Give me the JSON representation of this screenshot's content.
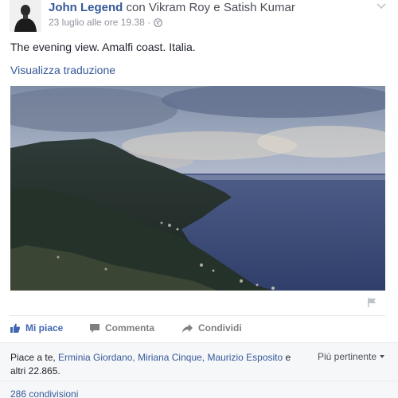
{
  "header": {
    "author": "John Legend",
    "with_word": "con",
    "tagged_1": "Vikram Roy",
    "and_word": "e",
    "tagged_2": "Satish Kumar",
    "timestamp": "23 luglio alle ore 19.38 ·",
    "privacy_icon": "globe-icon",
    "menu_icon": "chevron-down-icon"
  },
  "post": {
    "text": "The evening view. Amalfi coast. Italia.",
    "translate": "Visualizza traduzione"
  },
  "actions": {
    "like": "Mi piace",
    "comment": "Commenta",
    "share": "Condividi"
  },
  "likes": {
    "prefix": "Piace a te, ",
    "names": "Erminia Giordano, Miriana Cinque, Maurizio Esposito",
    "suffix": " e altri 22.865."
  },
  "sort": {
    "label": "Più pertinente"
  },
  "shares": {
    "label": "286 condivisioni"
  },
  "colors": {
    "link_blue": "#365899",
    "like_blue": "#4267b2",
    "muted_gray": "#90949c",
    "panel_bg": "#f6f7f9"
  }
}
